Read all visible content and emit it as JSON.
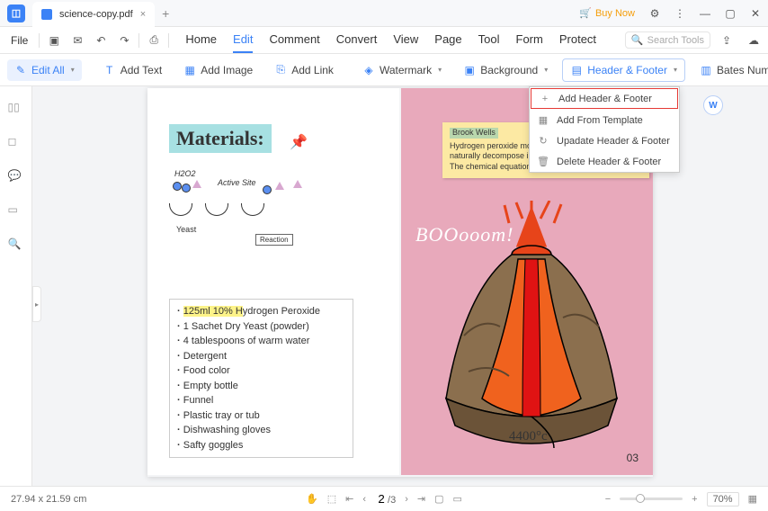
{
  "tab": {
    "title": "science-copy.pdf"
  },
  "buyNow": "Buy Now",
  "file": "File",
  "menus": {
    "home": "Home",
    "edit": "Edit",
    "comment": "Comment",
    "convert": "Convert",
    "view": "View",
    "page": "Page",
    "tool": "Tool",
    "form": "Form",
    "protect": "Protect"
  },
  "search": {
    "placeholder": "Search Tools"
  },
  "toolbar": {
    "editAll": "Edit All",
    "addText": "Add Text",
    "addImage": "Add Image",
    "addLink": "Add Link",
    "watermark": "Watermark",
    "background": "Background",
    "headerFooter": "Header & Footer",
    "batesNumber": "Bates Number"
  },
  "hfMenu": {
    "add": "Add Header & Footer",
    "template": "Add From Template",
    "update": "Upadate Header & Footer",
    "delete": "Delete Header & Footer"
  },
  "doc": {
    "materialsHeading": "Materials:",
    "diagram": {
      "h2o2": "H2O2",
      "activeSite": "Active Site",
      "yeast": "Yeast",
      "reaction": "Reaction"
    },
    "listHighlighted": "125ml 10% H",
    "listTail": "ydrogen Peroxide",
    "items": [
      "1 Sachet Dry Yeast (powder)",
      "4 tablespoons of warm water",
      "Detergent",
      "Food color",
      "Empty bottle",
      "Funnel",
      "Plastic tray or tub",
      "Dishwashing gloves",
      "Safty goggles"
    ],
    "note": {
      "author": "Brook Wells",
      "l1": "Hydrogen peroxide molecules a",
      "l2": "naturally decompose into water a",
      "l3": "The chemical equation for this decomposition is:"
    },
    "boom": "BOOooom!",
    "temp": "4400°c",
    "pagenum": "03"
  },
  "status": {
    "dims": "27.94 x 21.59 cm",
    "page": "2",
    "total": "/3",
    "zoom": "70%"
  }
}
